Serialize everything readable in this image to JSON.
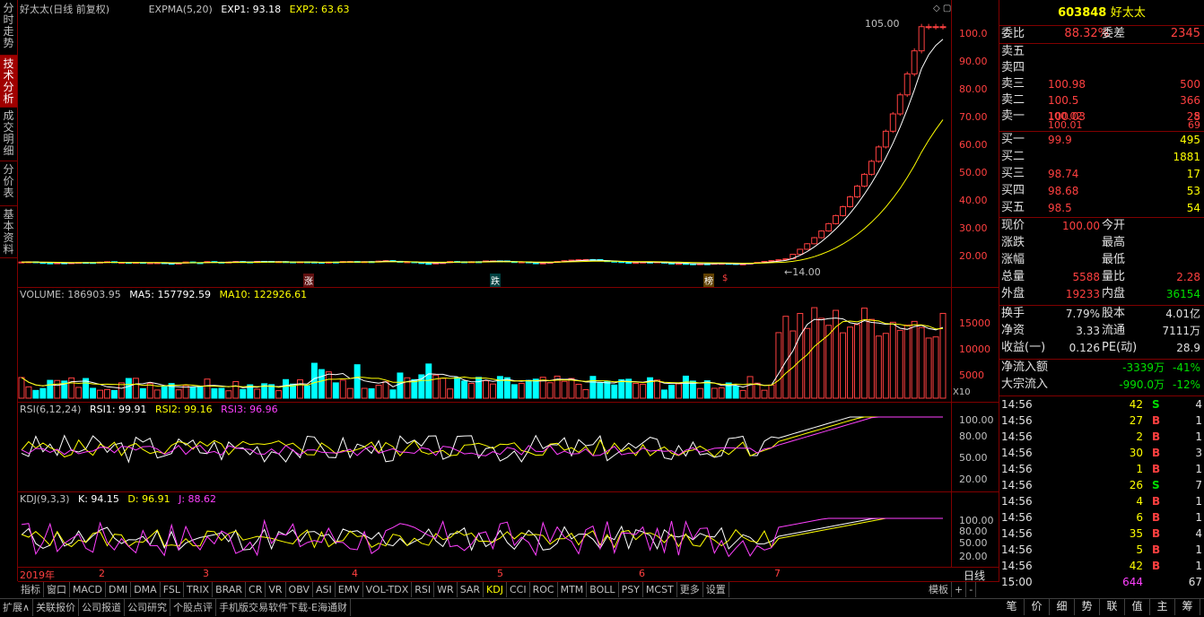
{
  "left_tabs": [
    "分时走势",
    "技术分析",
    "成交明细",
    "分价表",
    "基本资料"
  ],
  "active_left_tab": 1,
  "main_chart": {
    "stock_name": "好太太",
    "period": "(日线 前复权)",
    "indicator": "EXPMA(5,20)",
    "exp1": "EXP1: 93.18",
    "exp2": "EXP2: 63.63",
    "high_label": "105.00",
    "low_label": "14.00",
    "y_ticks": [
      "100.0",
      "90.00",
      "80.00",
      "70.00",
      "60.00",
      "50.00",
      "40.00",
      "30.00",
      "20.00"
    ],
    "markers": [
      "涨",
      "跌",
      "榜",
      "$"
    ]
  },
  "volume_panel": {
    "title": "VOLUME: 186903.95",
    "ma5": "MA5: 157792.59",
    "ma10": "MA10: 122926.61",
    "y_ticks": [
      "15000",
      "10000",
      "5000"
    ],
    "unit": "X10"
  },
  "rsi_panel": {
    "title": "RSI(6,12,24)",
    "rsi1": "RSI1: 99.91",
    "rsi2": "RSI2: 99.16",
    "rsi3": "RSI3: 96.96",
    "y_ticks": [
      "100.00",
      "80.00",
      "50.00",
      "20.00"
    ]
  },
  "kdj_panel": {
    "title": "KDJ(9,3,3)",
    "k": "K: 94.15",
    "d": "D: 96.91",
    "j": "J: 88.62",
    "y_ticks": [
      "100.00",
      "80.00",
      "50.00",
      "20.00"
    ]
  },
  "x_axis": {
    "labels": [
      "2019年",
      "2",
      "3",
      "4",
      "5",
      "6",
      "7"
    ],
    "period_button": "日线"
  },
  "indicator_tabs": [
    "指标",
    "窗口",
    "MACD",
    "DMI",
    "DMA",
    "FSL",
    "TRIX",
    "BRAR",
    "CR",
    "VR",
    "OBV",
    "ASI",
    "EMV",
    "VOL-TDX",
    "RSI",
    "WR",
    "SAR",
    "KDJ",
    "CCI",
    "ROC",
    "MTM",
    "BOLL",
    "PSY",
    "MCST",
    "更多",
    "设置"
  ],
  "active_indicator": "KDJ",
  "template_button": "模板",
  "status_tabs": [
    "扩展∧",
    "关联报价",
    "公司报道",
    "公司研究",
    "个股点评",
    "手机版交易软件下载-E海通财"
  ],
  "quote": {
    "code": "603848",
    "name": "好太太",
    "wei_bi_label": "委比",
    "wei_bi": "88.32%",
    "wei_cha_label": "委差",
    "wei_cha": "2345",
    "asks": [
      {
        "label": "卖五",
        "price": "",
        "vol": ""
      },
      {
        "label": "卖四",
        "price": "",
        "vol": ""
      },
      {
        "label": "卖三",
        "price": "100.98",
        "vol": "500"
      },
      {
        "label": "卖二",
        "price": "100.5",
        "vol": "366"
      },
      {
        "label": "卖一",
        "price": "100.03",
        "vol": "28"
      }
    ],
    "ask_extra": [
      {
        "price": "100.02",
        "vol": "5"
      },
      {
        "price": "100.01",
        "vol": "69"
      }
    ],
    "bids": [
      {
        "label": "买一",
        "price": "99.9",
        "vol": "495"
      },
      {
        "label": "买二",
        "price": "",
        "vol": "1881"
      },
      {
        "label": "买三",
        "price": "98.74",
        "vol": "17"
      },
      {
        "label": "买四",
        "price": "98.68",
        "vol": "53"
      },
      {
        "label": "买五",
        "price": "98.5",
        "vol": "54"
      }
    ],
    "stats_left": [
      {
        "label": "现价",
        "value": "100.00"
      },
      {
        "label": "涨跌",
        "value": ""
      },
      {
        "label": "涨幅",
        "value": ""
      },
      {
        "label": "总量",
        "value": "5588"
      },
      {
        "label": "外盘",
        "value": "19233"
      }
    ],
    "stats_right": [
      {
        "label": "今开",
        "value": ""
      },
      {
        "label": "最高",
        "value": ""
      },
      {
        "label": "最低",
        "value": ""
      },
      {
        "label": "量比",
        "value": "2.28"
      },
      {
        "label": "内盘",
        "value": "36154"
      }
    ],
    "finance": [
      {
        "l1": "换手",
        "v1": "7.79%",
        "l2": "股本",
        "v2": "4.01亿"
      },
      {
        "l1": "净资",
        "v1": "3.33",
        "l2": "流通",
        "v2": "7111万"
      },
      {
        "l1": "收益(一)",
        "v1": "0.126",
        "l2": "PE(动)",
        "v2": "28.9"
      }
    ],
    "flows": [
      {
        "label": "净流入额",
        "value": "-3339万",
        "pct": "-41%"
      },
      {
        "label": "大宗流入",
        "value": "-990.0万",
        "pct": "-12%"
      }
    ],
    "ticks": [
      {
        "time": "14:56",
        "price": "",
        "vol": "42",
        "bs": "S",
        "n": "4"
      },
      {
        "time": "14:56",
        "price": "",
        "vol": "27",
        "bs": "B",
        "n": "1"
      },
      {
        "time": "14:56",
        "price": "",
        "vol": "2",
        "bs": "B",
        "n": "1"
      },
      {
        "time": "14:56",
        "price": "",
        "vol": "30",
        "bs": "B",
        "n": "3"
      },
      {
        "time": "14:56",
        "price": "",
        "vol": "1",
        "bs": "B",
        "n": "1"
      },
      {
        "time": "14:56",
        "price": "",
        "vol": "26",
        "bs": "S",
        "n": "7"
      },
      {
        "time": "14:56",
        "price": "",
        "vol": "4",
        "bs": "B",
        "n": "1"
      },
      {
        "time": "14:56",
        "price": "",
        "vol": "6",
        "bs": "B",
        "n": "1"
      },
      {
        "time": "14:56",
        "price": "",
        "vol": "35",
        "bs": "B",
        "n": "4"
      },
      {
        "time": "14:56",
        "price": "",
        "vol": "5",
        "bs": "B",
        "n": "1"
      },
      {
        "time": "14:56",
        "price": "",
        "vol": "42",
        "bs": "B",
        "n": "1"
      },
      {
        "time": "15:00",
        "price": "",
        "vol": "644",
        "bs": "",
        "n": "67"
      }
    ],
    "bottom_tabs": [
      "笔",
      "价",
      "细",
      "势",
      "联",
      "值",
      "主",
      "筹"
    ]
  },
  "colors": {
    "up": "#ff4040",
    "down": "#00ffff",
    "border": "#800000",
    "ma1": "#ffffff",
    "ma2": "#ffff00",
    "ma3": "#ff40ff"
  }
}
